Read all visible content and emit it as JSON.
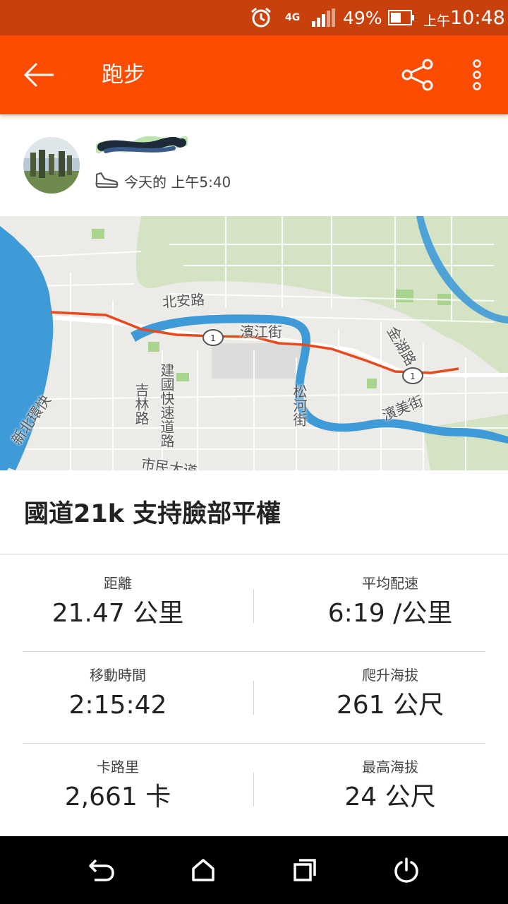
{
  "status_bar": {
    "network": "4G",
    "battery": "49%",
    "time_prefix": "上午",
    "time": "10:48"
  },
  "app_bar": {
    "title": "跑步",
    "icons": [
      "back-arrow-icon",
      "share-icon",
      "more-vert-icon"
    ]
  },
  "activity": {
    "time_text": "今天的 上午5:40",
    "title": "國道21k 支持臉部平權"
  },
  "map": {
    "labels": [
      "北安路",
      "濱江街",
      "金湖路",
      "吉林路",
      "建國快速道路",
      "松河街",
      "濱美街",
      "新北環快",
      "市民大道"
    ]
  },
  "stats": [
    {
      "label": "距離",
      "value": "21.47 公里"
    },
    {
      "label": "平均配速",
      "value": "6:19 /公里"
    },
    {
      "label": "移動時間",
      "value": "2:15:42"
    },
    {
      "label": "爬升海拔",
      "value": "261 公尺"
    },
    {
      "label": "卡路里",
      "value": "2,661 卡"
    },
    {
      "label": "最高海拔",
      "value": "24 公尺"
    }
  ],
  "nav_bar": {
    "icons": [
      "back-icon",
      "home-icon",
      "recents-icon",
      "power-icon"
    ]
  },
  "colors": {
    "accent": "#fc4c02",
    "status_bar": "#c8400b",
    "route": "#e8481b",
    "river": "#3f9ad8"
  }
}
